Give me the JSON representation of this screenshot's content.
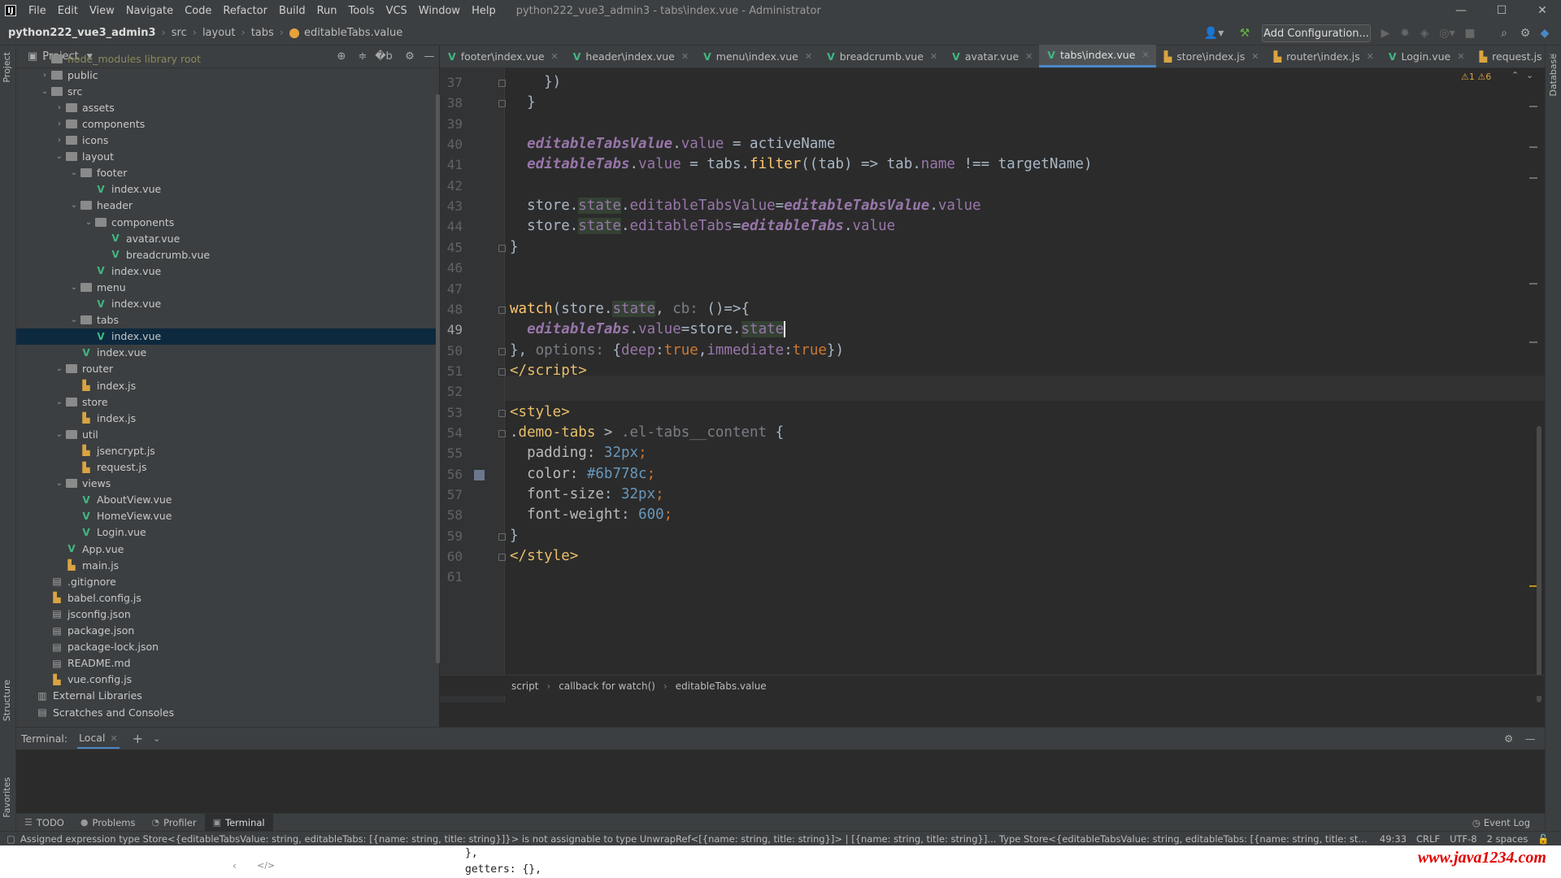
{
  "menubar": {
    "items": [
      "File",
      "Edit",
      "View",
      "Navigate",
      "Code",
      "Refactor",
      "Build",
      "Run",
      "Tools",
      "VCS",
      "Window",
      "Help"
    ],
    "window_title": "python222_vue3_admin3 - tabs\\index.vue - Administrator"
  },
  "navbar": {
    "crumbs": [
      "python222_vue3_admin3",
      "src",
      "layout",
      "tabs",
      "editableTabs.value"
    ],
    "add_config": "Add Configuration..."
  },
  "project": {
    "title": "Project",
    "tree": [
      {
        "label": "node_modules  library root",
        "depth": 1,
        "kind": "folder",
        "open": false
      },
      {
        "label": "public",
        "depth": 1,
        "kind": "folder",
        "open": false
      },
      {
        "label": "src",
        "depth": 1,
        "kind": "folder",
        "open": true
      },
      {
        "label": "assets",
        "depth": 2,
        "kind": "folder",
        "open": false
      },
      {
        "label": "components",
        "depth": 2,
        "kind": "folder",
        "open": false
      },
      {
        "label": "icons",
        "depth": 2,
        "kind": "folder",
        "open": false
      },
      {
        "label": "layout",
        "depth": 2,
        "kind": "folder",
        "open": true
      },
      {
        "label": "footer",
        "depth": 3,
        "kind": "folder",
        "open": true
      },
      {
        "label": "index.vue",
        "depth": 4,
        "kind": "vue"
      },
      {
        "label": "header",
        "depth": 3,
        "kind": "folder",
        "open": true
      },
      {
        "label": "components",
        "depth": 4,
        "kind": "folder",
        "open": true
      },
      {
        "label": "avatar.vue",
        "depth": 5,
        "kind": "vue"
      },
      {
        "label": "breadcrumb.vue",
        "depth": 5,
        "kind": "vue"
      },
      {
        "label": "index.vue",
        "depth": 4,
        "kind": "vue"
      },
      {
        "label": "menu",
        "depth": 3,
        "kind": "folder",
        "open": true
      },
      {
        "label": "index.vue",
        "depth": 4,
        "kind": "vue"
      },
      {
        "label": "tabs",
        "depth": 3,
        "kind": "folder",
        "open": true
      },
      {
        "label": "index.vue",
        "depth": 4,
        "kind": "vue",
        "selected": true
      },
      {
        "label": "index.vue",
        "depth": 3,
        "kind": "vue"
      },
      {
        "label": "router",
        "depth": 2,
        "kind": "folder",
        "open": true
      },
      {
        "label": "index.js",
        "depth": 3,
        "kind": "js"
      },
      {
        "label": "store",
        "depth": 2,
        "kind": "folder",
        "open": true
      },
      {
        "label": "index.js",
        "depth": 3,
        "kind": "js"
      },
      {
        "label": "util",
        "depth": 2,
        "kind": "folder",
        "open": true
      },
      {
        "label": "jsencrypt.js",
        "depth": 3,
        "kind": "js"
      },
      {
        "label": "request.js",
        "depth": 3,
        "kind": "js"
      },
      {
        "label": "views",
        "depth": 2,
        "kind": "folder",
        "open": true
      },
      {
        "label": "AboutView.vue",
        "depth": 3,
        "kind": "vue"
      },
      {
        "label": "HomeView.vue",
        "depth": 3,
        "kind": "vue"
      },
      {
        "label": "Login.vue",
        "depth": 3,
        "kind": "vue"
      },
      {
        "label": "App.vue",
        "depth": 2,
        "kind": "vue"
      },
      {
        "label": "main.js",
        "depth": 2,
        "kind": "js"
      },
      {
        "label": ".gitignore",
        "depth": 1,
        "kind": "cfg"
      },
      {
        "label": "babel.config.js",
        "depth": 1,
        "kind": "js"
      },
      {
        "label": "jsconfig.json",
        "depth": 1,
        "kind": "cfg"
      },
      {
        "label": "package.json",
        "depth": 1,
        "kind": "cfg"
      },
      {
        "label": "package-lock.json",
        "depth": 1,
        "kind": "cfg"
      },
      {
        "label": "README.md",
        "depth": 1,
        "kind": "cfg"
      },
      {
        "label": "vue.config.js",
        "depth": 1,
        "kind": "js"
      },
      {
        "label": "External Libraries",
        "depth": 0,
        "kind": "lib"
      },
      {
        "label": "Scratches and Consoles",
        "depth": 0,
        "kind": "cfg"
      }
    ]
  },
  "tabs": [
    {
      "label": "footer\\index.vue",
      "kind": "vue"
    },
    {
      "label": "header\\index.vue",
      "kind": "vue"
    },
    {
      "label": "menu\\index.vue",
      "kind": "vue"
    },
    {
      "label": "breadcrumb.vue",
      "kind": "vue"
    },
    {
      "label": "avatar.vue",
      "kind": "vue"
    },
    {
      "label": "tabs\\index.vue",
      "kind": "vue",
      "active": true
    },
    {
      "label": "store\\index.js",
      "kind": "js"
    },
    {
      "label": "router\\index.js",
      "kind": "js"
    },
    {
      "label": "Login.vue",
      "kind": "vue"
    },
    {
      "label": "request.js",
      "kind": "js"
    }
  ],
  "editor": {
    "inspection": "⚠1  ⚠6",
    "current_line": 49,
    "lines": [
      {
        "n": 37,
        "html": "    })"
      },
      {
        "n": 38,
        "html": "  }"
      },
      {
        "n": 39,
        "html": ""
      },
      {
        "n": 40,
        "html": "  <span class=\"it\">editableTabsValue</span>.<span class=\"p\">value</span> = activeName"
      },
      {
        "n": 41,
        "html": "  <span class=\"it\">editableTabs</span>.<span class=\"p\">value</span> = tabs.<span class=\"f\">filter</span>((tab) => tab.<span class=\"p\">name</span> !== targetName)"
      },
      {
        "n": 42,
        "html": ""
      },
      {
        "n": 43,
        "html": "  store.<span class=\"p sh\">state</span>.<span class=\"p\">editableTabsValue</span>=<span class=\"it\">editableTabsValue</span>.<span class=\"p\">value</span>"
      },
      {
        "n": 44,
        "html": "  store.<span class=\"p sh\">state</span>.<span class=\"p\">editableTabs</span>=<span class=\"it\">editableTabs</span>.<span class=\"p\">value</span>"
      },
      {
        "n": 45,
        "html": "}"
      },
      {
        "n": 46,
        "html": ""
      },
      {
        "n": 47,
        "html": ""
      },
      {
        "n": 48,
        "html": "<span class=\"f\">watch</span>(store.<span class=\"p sh\">state</span>, <span class=\"hint\">cb:</span> ()=>{"
      },
      {
        "n": 49,
        "html": "  <span class=\"it\">editableTabs</span>.<span class=\"p\">value</span>=store.<span class=\"p sh\">state</span><span class=\"cursor\"></span>"
      },
      {
        "n": 50,
        "html": "}, <span class=\"hint\">options:</span> {<span class=\"p\">deep</span>:<span class=\"k\">true</span>,<span class=\"p\">immediate</span>:<span class=\"k\">true</span>})"
      },
      {
        "n": 51,
        "html": "<span class=\"t\">&lt;/script&gt;</span>"
      },
      {
        "n": 52,
        "html": ""
      },
      {
        "n": 53,
        "html": "<span class=\"t\">&lt;style&gt;</span>"
      },
      {
        "n": 54,
        "html": ".<span class=\"t\">demo-tabs</span> > <span class=\"hint\">.el-tabs__content</span> {"
      },
      {
        "n": 55,
        "html": "  <span style=\"color:#bababa\">padding</span>: <span class=\"n\">32px</span><span class=\"k\">;</span>"
      },
      {
        "n": 56,
        "html": "  <span style=\"color:#bababa\">color</span>: <span class=\"n\">#6b778c</span><span class=\"k\">;</span>"
      },
      {
        "n": 57,
        "html": "  <span style=\"color:#bababa\">font-size</span>: <span class=\"n\">32px</span><span class=\"k\">;</span>"
      },
      {
        "n": 58,
        "html": "  <span style=\"color:#bababa\">font-weight</span>: <span class=\"n\">600</span><span class=\"k\">;</span>"
      },
      {
        "n": 59,
        "html": "}"
      },
      {
        "n": 60,
        "html": "<span class=\"t\">&lt;/style&gt;</span>"
      },
      {
        "n": 61,
        "html": ""
      }
    ],
    "breadcrumb": [
      "script",
      "callback for watch()",
      "editableTabs.value"
    ]
  },
  "terminal": {
    "title": "Terminal:",
    "tab": "Local"
  },
  "toolwindows": [
    {
      "label": "TODO",
      "glyph": "☰"
    },
    {
      "label": "Problems",
      "glyph": "●"
    },
    {
      "label": "Profiler",
      "glyph": "◔"
    },
    {
      "label": "Terminal",
      "glyph": "▣",
      "active": true
    }
  ],
  "event_log": "Event Log",
  "side_labels": {
    "project": "Project",
    "structure": "Structure",
    "favorites": "Favorites",
    "database": "Database"
  },
  "status": {
    "message": "Assigned expression type Store<{editableTabsValue: string, editableTabs: [{name: string, title: string}]}> is not assignable to type UnwrapRef<[{name: string, title: string}]> | [{name: string, title: string}]...  Type Store<{editableTabsValue: string, editableTabs: [{name: string, title: string...",
    "position": "49:33",
    "line_sep": "CRLF",
    "encoding": "UTF-8",
    "indent": "2 spaces"
  },
  "overlay": {
    "code1": "},",
    "code2": "getters: {},",
    "watermark": "www.java1234.com"
  }
}
